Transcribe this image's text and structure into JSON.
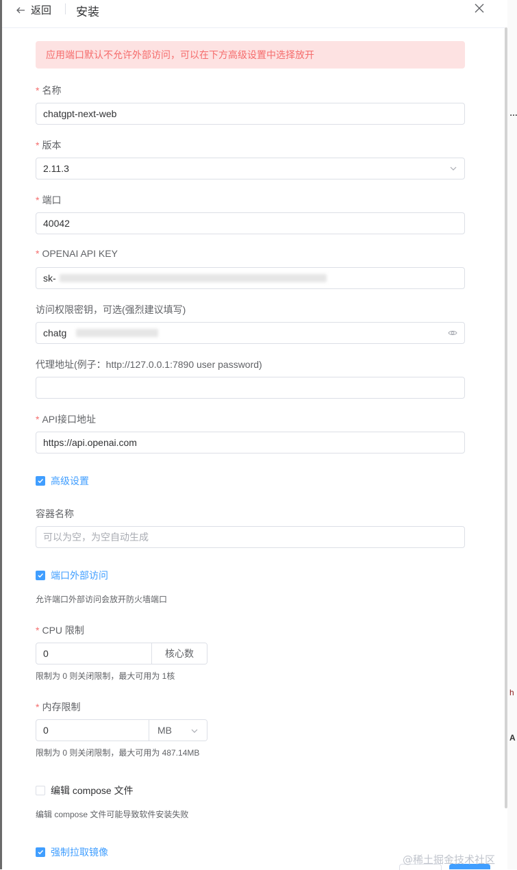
{
  "header": {
    "back_label": "返回",
    "title": "安装"
  },
  "alert": "应用端口默认不允许外部访问，可以在下方高级设置中选择放开",
  "fields": {
    "name": {
      "label": "名称",
      "value": "chatgpt-next-web"
    },
    "version": {
      "label": "版本",
      "value": "2.11.3"
    },
    "port": {
      "label": "端口",
      "value": "40042"
    },
    "api_key": {
      "label": "OPENAI API KEY",
      "value": "sk-"
    },
    "access_code": {
      "label": "访问权限密钥，可选(强烈建议填写)",
      "value": "chatg"
    },
    "proxy": {
      "label": "代理地址(例子：http://127.0.0.1:7890 user password)",
      "value": ""
    },
    "base_url": {
      "label": "API接口地址",
      "value": "https://api.openai.com"
    }
  },
  "advanced": {
    "label": "高级设置",
    "checked": true
  },
  "container": {
    "label": "容器名称",
    "placeholder": "可以为空，为空自动生成"
  },
  "allow_port": {
    "label": "端口外部访问",
    "checked": true,
    "help": "允许端口外部访问会放开防火墙端口"
  },
  "cpu": {
    "label": "CPU 限制",
    "value": "0",
    "unit": "核心数",
    "help": "限制为 0 则关闭限制，最大可用为 1核"
  },
  "memory": {
    "label": "内存限制",
    "value": "0",
    "unit": "MB",
    "help": "限制为 0 则关闭限制，最大可用为 487.14MB"
  },
  "compose": {
    "label": "编辑 compose 文件",
    "checked": false,
    "help": "编辑 compose 文件可能导致软件安装失败"
  },
  "pull_image": {
    "label": "强制拉取镜像",
    "checked": true
  },
  "side_text": {
    "t1": "…",
    "t2": "h",
    "t3": "A"
  },
  "watermark": "@稀土掘金技术社区",
  "colors": {
    "primary": "#409eff",
    "danger": "#f56c6c",
    "alert_bg": "#fde2e2",
    "border": "#dcdfe6"
  },
  "icons": [
    "arrow-left-icon",
    "close-icon",
    "chevron-down-icon",
    "eye-icon",
    "check-icon"
  ]
}
